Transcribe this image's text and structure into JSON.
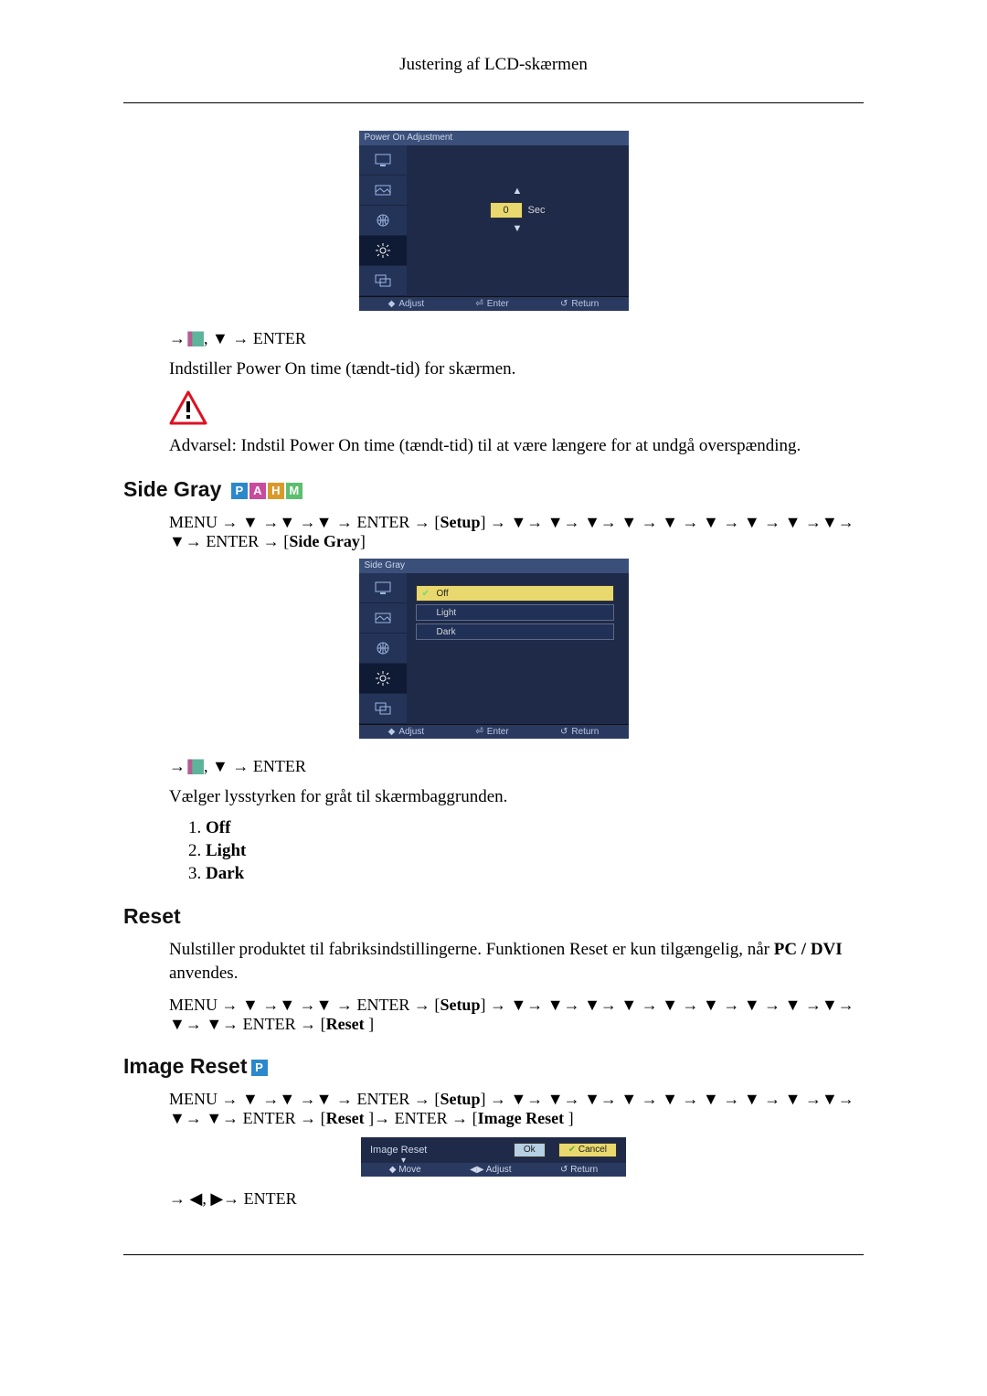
{
  "header_title": "Justering af LCD-skærmen",
  "osd_power_on": {
    "title": "Power On Adjustment",
    "value": "0",
    "unit": "Sec",
    "footer": {
      "a": "Adjust",
      "b": "Enter",
      "c": "Return"
    }
  },
  "power_on_nav": {
    "tail": " ENTER"
  },
  "power_on_desc": "Indstiller Power On time (tændt-tid) for skærmen.",
  "power_on_warning": "Advarsel: Indstil Power On time (tændt-tid) til at være længere for at undgå overspænding.",
  "section_side_gray": "Side Gray",
  "side_gray_nav_part1": "MENU → ▼ →▼ →▼ → ENTER → [",
  "side_gray_nav_setup": "Setup",
  "side_gray_nav_part2": "] → ▼→ ▼→ ▼→ ▼ → ▼ → ▼ → ▼ → ▼ →▼→ ▼→ ENTER → [",
  "side_gray_nav_label": "Side Gray",
  "side_gray_nav_part3": "]",
  "osd_side_gray": {
    "title": "Side Gray",
    "options": [
      "Off",
      "Light",
      "Dark"
    ],
    "selected_index": 0,
    "footer": {
      "a": "Adjust",
      "b": "Enter",
      "c": "Return"
    }
  },
  "side_gray_nav2_tail": " ENTER",
  "side_gray_desc": "Vælger lysstyrken for gråt til skærmbaggrunden.",
  "side_gray_options": [
    "Off",
    "Light",
    "Dark"
  ],
  "section_reset": "Reset",
  "reset_desc_part1": "Nulstiller produktet til fabriksindstillingerne. Funktionen Reset er kun tilgængelig, når ",
  "reset_desc_bold": "PC / DVI",
  "reset_desc_part2": " anvendes.",
  "reset_nav_part1": "MENU → ▼ →▼ →▼ → ENTER → [",
  "reset_nav_setup": "Setup",
  "reset_nav_part2": "] → ▼→ ▼→ ▼→ ▼ → ▼ → ▼ → ▼ → ▼ →▼→ ▼→ ▼→ ENTER → [",
  "reset_nav_label": "Reset ",
  "reset_nav_part3": "]",
  "section_image_reset": "Image Reset",
  "image_reset_nav_part1": "MENU → ▼ →▼ →▼ → ENTER → [",
  "image_reset_nav_setup": "Setup",
  "image_reset_nav_part2": "] → ▼→ ▼→ ▼→ ▼ → ▼ → ▼ → ▼ → ▼ →▼→ ▼→ ▼→ ENTER → [",
  "image_reset_nav_label1": "Reset ",
  "image_reset_nav_mid": "]→ ENTER → [",
  "image_reset_nav_label2": "Image Reset ",
  "image_reset_nav_part3": "]",
  "image_reset_dialog": {
    "title": "Image Reset",
    "ok": "Ok",
    "cancel": "Cancel",
    "footer": {
      "a": "Move",
      "b": "Adjust",
      "c": "Return"
    }
  },
  "image_reset_nav2": "→ ◀, ▶→ ENTER",
  "mode_letters": {
    "p": "P",
    "a": "A",
    "h": "H",
    "m": "M"
  }
}
